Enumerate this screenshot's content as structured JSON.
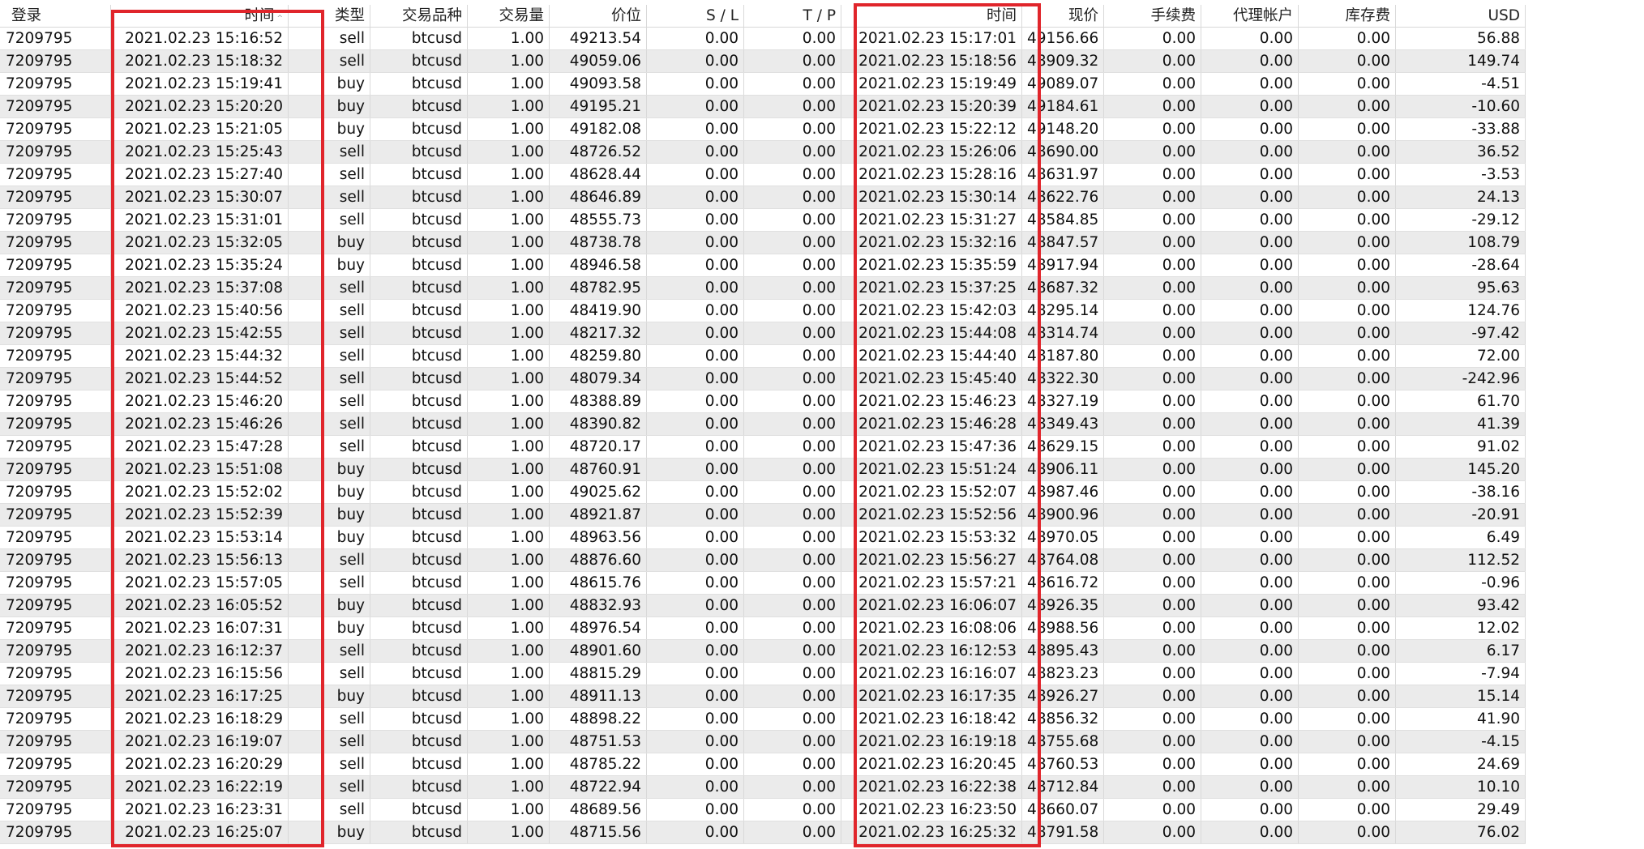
{
  "table": {
    "columns": [
      {
        "key": "login",
        "label": "登录",
        "w": 137,
        "align": "left",
        "hl": "left"
      },
      {
        "key": "open_time",
        "label": "时间",
        "w": 219,
        "align": "right",
        "sorted": true
      },
      {
        "key": "type",
        "label": "类型",
        "w": 101,
        "align": "right"
      },
      {
        "key": "symbol",
        "label": "交易品种",
        "w": 120,
        "align": "right"
      },
      {
        "key": "volume",
        "label": "交易量",
        "w": 101,
        "align": "right"
      },
      {
        "key": "open_price",
        "label": "价位",
        "w": 120,
        "align": "right"
      },
      {
        "key": "sl",
        "label": "S / L",
        "w": 120,
        "align": "right"
      },
      {
        "key": "tp",
        "label": "T / P",
        "w": 120,
        "align": "right"
      },
      {
        "key": "close_time",
        "label": "时间",
        "w": 223,
        "align": "right"
      },
      {
        "key": "close_price",
        "label": "现价",
        "w": 101,
        "align": "right"
      },
      {
        "key": "commission",
        "label": "手续费",
        "w": 120,
        "align": "right"
      },
      {
        "key": "agent",
        "label": "代理帐户",
        "w": 120,
        "align": "right"
      },
      {
        "key": "swap",
        "label": "库存费",
        "w": 120,
        "align": "right"
      },
      {
        "key": "usd",
        "label": "USD",
        "w": 160,
        "align": "right"
      }
    ],
    "rows": [
      [
        "7209795",
        "2021.02.23 15:16:52",
        "sell",
        "btcusd",
        "1.00",
        "49213.54",
        "0.00",
        "0.00",
        "2021.02.23 15:17:01",
        "49156.66",
        "0.00",
        "0.00",
        "0.00",
        "56.88"
      ],
      [
        "7209795",
        "2021.02.23 15:18:32",
        "sell",
        "btcusd",
        "1.00",
        "49059.06",
        "0.00",
        "0.00",
        "2021.02.23 15:18:56",
        "48909.32",
        "0.00",
        "0.00",
        "0.00",
        "149.74"
      ],
      [
        "7209795",
        "2021.02.23 15:19:41",
        "buy",
        "btcusd",
        "1.00",
        "49093.58",
        "0.00",
        "0.00",
        "2021.02.23 15:19:49",
        "49089.07",
        "0.00",
        "0.00",
        "0.00",
        "-4.51"
      ],
      [
        "7209795",
        "2021.02.23 15:20:20",
        "buy",
        "btcusd",
        "1.00",
        "49195.21",
        "0.00",
        "0.00",
        "2021.02.23 15:20:39",
        "49184.61",
        "0.00",
        "0.00",
        "0.00",
        "-10.60"
      ],
      [
        "7209795",
        "2021.02.23 15:21:05",
        "buy",
        "btcusd",
        "1.00",
        "49182.08",
        "0.00",
        "0.00",
        "2021.02.23 15:22:12",
        "49148.20",
        "0.00",
        "0.00",
        "0.00",
        "-33.88"
      ],
      [
        "7209795",
        "2021.02.23 15:25:43",
        "sell",
        "btcusd",
        "1.00",
        "48726.52",
        "0.00",
        "0.00",
        "2021.02.23 15:26:06",
        "48690.00",
        "0.00",
        "0.00",
        "0.00",
        "36.52"
      ],
      [
        "7209795",
        "2021.02.23 15:27:40",
        "sell",
        "btcusd",
        "1.00",
        "48628.44",
        "0.00",
        "0.00",
        "2021.02.23 15:28:16",
        "48631.97",
        "0.00",
        "0.00",
        "0.00",
        "-3.53"
      ],
      [
        "7209795",
        "2021.02.23 15:30:07",
        "sell",
        "btcusd",
        "1.00",
        "48646.89",
        "0.00",
        "0.00",
        "2021.02.23 15:30:14",
        "48622.76",
        "0.00",
        "0.00",
        "0.00",
        "24.13"
      ],
      [
        "7209795",
        "2021.02.23 15:31:01",
        "sell",
        "btcusd",
        "1.00",
        "48555.73",
        "0.00",
        "0.00",
        "2021.02.23 15:31:27",
        "48584.85",
        "0.00",
        "0.00",
        "0.00",
        "-29.12"
      ],
      [
        "7209795",
        "2021.02.23 15:32:05",
        "buy",
        "btcusd",
        "1.00",
        "48738.78",
        "0.00",
        "0.00",
        "2021.02.23 15:32:16",
        "48847.57",
        "0.00",
        "0.00",
        "0.00",
        "108.79"
      ],
      [
        "7209795",
        "2021.02.23 15:35:24",
        "buy",
        "btcusd",
        "1.00",
        "48946.58",
        "0.00",
        "0.00",
        "2021.02.23 15:35:59",
        "48917.94",
        "0.00",
        "0.00",
        "0.00",
        "-28.64"
      ],
      [
        "7209795",
        "2021.02.23 15:37:08",
        "sell",
        "btcusd",
        "1.00",
        "48782.95",
        "0.00",
        "0.00",
        "2021.02.23 15:37:25",
        "48687.32",
        "0.00",
        "0.00",
        "0.00",
        "95.63"
      ],
      [
        "7209795",
        "2021.02.23 15:40:56",
        "sell",
        "btcusd",
        "1.00",
        "48419.90",
        "0.00",
        "0.00",
        "2021.02.23 15:42:03",
        "48295.14",
        "0.00",
        "0.00",
        "0.00",
        "124.76"
      ],
      [
        "7209795",
        "2021.02.23 15:42:55",
        "sell",
        "btcusd",
        "1.00",
        "48217.32",
        "0.00",
        "0.00",
        "2021.02.23 15:44:08",
        "48314.74",
        "0.00",
        "0.00",
        "0.00",
        "-97.42"
      ],
      [
        "7209795",
        "2021.02.23 15:44:32",
        "sell",
        "btcusd",
        "1.00",
        "48259.80",
        "0.00",
        "0.00",
        "2021.02.23 15:44:40",
        "48187.80",
        "0.00",
        "0.00",
        "0.00",
        "72.00"
      ],
      [
        "7209795",
        "2021.02.23 15:44:52",
        "sell",
        "btcusd",
        "1.00",
        "48079.34",
        "0.00",
        "0.00",
        "2021.02.23 15:45:40",
        "48322.30",
        "0.00",
        "0.00",
        "0.00",
        "-242.96"
      ],
      [
        "7209795",
        "2021.02.23 15:46:20",
        "sell",
        "btcusd",
        "1.00",
        "48388.89",
        "0.00",
        "0.00",
        "2021.02.23 15:46:23",
        "48327.19",
        "0.00",
        "0.00",
        "0.00",
        "61.70"
      ],
      [
        "7209795",
        "2021.02.23 15:46:26",
        "sell",
        "btcusd",
        "1.00",
        "48390.82",
        "0.00",
        "0.00",
        "2021.02.23 15:46:28",
        "48349.43",
        "0.00",
        "0.00",
        "0.00",
        "41.39"
      ],
      [
        "7209795",
        "2021.02.23 15:47:28",
        "sell",
        "btcusd",
        "1.00",
        "48720.17",
        "0.00",
        "0.00",
        "2021.02.23 15:47:36",
        "48629.15",
        "0.00",
        "0.00",
        "0.00",
        "91.02"
      ],
      [
        "7209795",
        "2021.02.23 15:51:08",
        "buy",
        "btcusd",
        "1.00",
        "48760.91",
        "0.00",
        "0.00",
        "2021.02.23 15:51:24",
        "48906.11",
        "0.00",
        "0.00",
        "0.00",
        "145.20"
      ],
      [
        "7209795",
        "2021.02.23 15:52:02",
        "buy",
        "btcusd",
        "1.00",
        "49025.62",
        "0.00",
        "0.00",
        "2021.02.23 15:52:07",
        "48987.46",
        "0.00",
        "0.00",
        "0.00",
        "-38.16"
      ],
      [
        "7209795",
        "2021.02.23 15:52:39",
        "buy",
        "btcusd",
        "1.00",
        "48921.87",
        "0.00",
        "0.00",
        "2021.02.23 15:52:56",
        "48900.96",
        "0.00",
        "0.00",
        "0.00",
        "-20.91"
      ],
      [
        "7209795",
        "2021.02.23 15:53:14",
        "buy",
        "btcusd",
        "1.00",
        "48963.56",
        "0.00",
        "0.00",
        "2021.02.23 15:53:32",
        "48970.05",
        "0.00",
        "0.00",
        "0.00",
        "6.49"
      ],
      [
        "7209795",
        "2021.02.23 15:56:13",
        "sell",
        "btcusd",
        "1.00",
        "48876.60",
        "0.00",
        "0.00",
        "2021.02.23 15:56:27",
        "48764.08",
        "0.00",
        "0.00",
        "0.00",
        "112.52"
      ],
      [
        "7209795",
        "2021.02.23 15:57:05",
        "sell",
        "btcusd",
        "1.00",
        "48615.76",
        "0.00",
        "0.00",
        "2021.02.23 15:57:21",
        "48616.72",
        "0.00",
        "0.00",
        "0.00",
        "-0.96"
      ],
      [
        "7209795",
        "2021.02.23 16:05:52",
        "buy",
        "btcusd",
        "1.00",
        "48832.93",
        "0.00",
        "0.00",
        "2021.02.23 16:06:07",
        "48926.35",
        "0.00",
        "0.00",
        "0.00",
        "93.42"
      ],
      [
        "7209795",
        "2021.02.23 16:07:31",
        "buy",
        "btcusd",
        "1.00",
        "48976.54",
        "0.00",
        "0.00",
        "2021.02.23 16:08:06",
        "48988.56",
        "0.00",
        "0.00",
        "0.00",
        "12.02"
      ],
      [
        "7209795",
        "2021.02.23 16:12:37",
        "sell",
        "btcusd",
        "1.00",
        "48901.60",
        "0.00",
        "0.00",
        "2021.02.23 16:12:53",
        "48895.43",
        "0.00",
        "0.00",
        "0.00",
        "6.17"
      ],
      [
        "7209795",
        "2021.02.23 16:15:56",
        "sell",
        "btcusd",
        "1.00",
        "48815.29",
        "0.00",
        "0.00",
        "2021.02.23 16:16:07",
        "48823.23",
        "0.00",
        "0.00",
        "0.00",
        "-7.94"
      ],
      [
        "7209795",
        "2021.02.23 16:17:25",
        "buy",
        "btcusd",
        "1.00",
        "48911.13",
        "0.00",
        "0.00",
        "2021.02.23 16:17:35",
        "48926.27",
        "0.00",
        "0.00",
        "0.00",
        "15.14"
      ],
      [
        "7209795",
        "2021.02.23 16:18:29",
        "sell",
        "btcusd",
        "1.00",
        "48898.22",
        "0.00",
        "0.00",
        "2021.02.23 16:18:42",
        "48856.32",
        "0.00",
        "0.00",
        "0.00",
        "41.90"
      ],
      [
        "7209795",
        "2021.02.23 16:19:07",
        "sell",
        "btcusd",
        "1.00",
        "48751.53",
        "0.00",
        "0.00",
        "2021.02.23 16:19:18",
        "48755.68",
        "0.00",
        "0.00",
        "0.00",
        "-4.15"
      ],
      [
        "7209795",
        "2021.02.23 16:20:29",
        "sell",
        "btcusd",
        "1.00",
        "48785.22",
        "0.00",
        "0.00",
        "2021.02.23 16:20:45",
        "48760.53",
        "0.00",
        "0.00",
        "0.00",
        "24.69"
      ],
      [
        "7209795",
        "2021.02.23 16:22:19",
        "sell",
        "btcusd",
        "1.00",
        "48722.94",
        "0.00",
        "0.00",
        "2021.02.23 16:22:38",
        "48712.84",
        "0.00",
        "0.00",
        "0.00",
        "10.10"
      ],
      [
        "7209795",
        "2021.02.23 16:23:31",
        "sell",
        "btcusd",
        "1.00",
        "48689.56",
        "0.00",
        "0.00",
        "2021.02.23 16:23:50",
        "48660.07",
        "0.00",
        "0.00",
        "0.00",
        "29.49"
      ],
      [
        "7209795",
        "2021.02.23 16:25:07",
        "buy",
        "btcusd",
        "1.00",
        "48715.56",
        "0.00",
        "0.00",
        "2021.02.23 16:25:32",
        "48791.58",
        "0.00",
        "0.00",
        "0.00",
        "76.02"
      ]
    ]
  },
  "highlight_color": "#e0252b"
}
